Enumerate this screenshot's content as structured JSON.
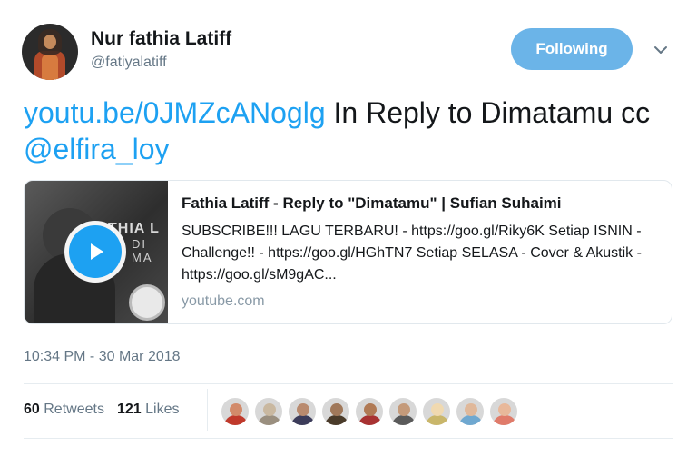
{
  "author": {
    "display_name": "Nur fathia Latiff",
    "handle": "@fatiyalatiff"
  },
  "follow_button": {
    "label": "Following",
    "color": "#6bb4e8"
  },
  "tweet": {
    "link_text": "youtu.be/0JMZcANoglg",
    "text_after_link": " In Reply to Dimatamu cc ",
    "mention": "@elfira_loy"
  },
  "card": {
    "title": "Fathia Latiff - Reply to \"Dimatamu\" | Sufian Suhaimi",
    "description": "SUBSCRIBE!!! LAGU TERBARU! - https://goo.gl/Riky6K Setiap ISNIN - Challenge!! - https://goo.gl/HGhTN7 Setiap SELASA - Cover & Akustik - https://goo.gl/sM9gAC...",
    "domain": "youtube.com",
    "thumb_text_line1": "THIA L",
    "thumb_text_line2": "DI MA"
  },
  "timestamp": "10:34 PM - 30 Mar 2018",
  "stats": {
    "retweets_count": "60",
    "retweets_label": "Retweets",
    "likes_count": "121",
    "likes_label": "Likes"
  },
  "likers": [
    {
      "face": "#d28a6a",
      "body": "#c0392b"
    },
    {
      "face": "#c9b8a0",
      "body": "#9a8f7f"
    },
    {
      "face": "#b98a6e",
      "body": "#3c3c5a"
    },
    {
      "face": "#a0785a",
      "body": "#4a3b2a"
    },
    {
      "face": "#b07a55",
      "body": "#a83232"
    },
    {
      "face": "#c49a7a",
      "body": "#5a5a5a"
    },
    {
      "face": "#f0d9b0",
      "body": "#c9b66a"
    },
    {
      "face": "#e0b89a",
      "body": "#6fa8d0"
    },
    {
      "face": "#e8b89a",
      "body": "#e07b6a"
    }
  ],
  "colors": {
    "link": "#1da1f2",
    "secondary_text": "#657786",
    "divider": "#e6ecf0"
  }
}
